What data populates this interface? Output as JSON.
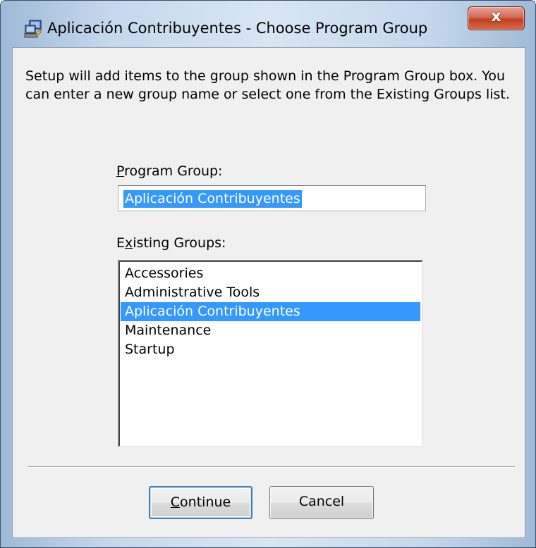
{
  "window": {
    "title": "Aplicación Contribuyentes - Choose Program Group",
    "close_glyph": "x",
    "icon": "setup-computer-icon"
  },
  "description": "Setup will add items to the group shown in the Program Group box. You can enter a new group name or select one from the Existing Groups list.",
  "program_group": {
    "label_accel": "P",
    "label_rest": "rogram Group:",
    "value": "Aplicación Contribuyentes"
  },
  "existing_groups": {
    "label_pre": "E",
    "label_accel": "x",
    "label_rest": "isting Groups:",
    "items": [
      "Accessories",
      "Administrative Tools",
      "Aplicación Contribuyentes",
      "Maintenance",
      "Startup"
    ],
    "selected": "Aplicación Contribuyentes"
  },
  "buttons": {
    "continue_accel": "C",
    "continue_rest": "ontinue",
    "cancel": "Cancel"
  },
  "colors": {
    "selection": "#3399ff",
    "close_button": "#c2401f",
    "dialog_face": "#f0f0f0"
  }
}
